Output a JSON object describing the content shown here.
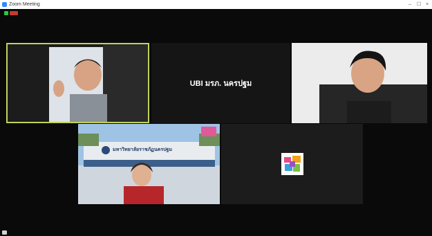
{
  "window": {
    "title": "Zoom Meeting",
    "minimize_glyph": "–",
    "maximize_glyph": "☐",
    "close_glyph": "×"
  },
  "tiles": [
    {
      "id": "speaker-left",
      "name": "",
      "active": true
    },
    {
      "id": "text-tile",
      "name": "",
      "display_text": "UBI มรภ. นครปฐม"
    },
    {
      "id": "speaker-right",
      "name": ""
    },
    {
      "id": "campus-tile",
      "name": "",
      "banner_text": "มหาวิทยาลัยราชภัฏนครปฐม"
    },
    {
      "id": "avatar-tile",
      "name": ""
    }
  ],
  "colors": {
    "active_border": "#c3d35a",
    "tile_bg": "#1a1a1a",
    "app_bg": "#0a0a0a"
  }
}
